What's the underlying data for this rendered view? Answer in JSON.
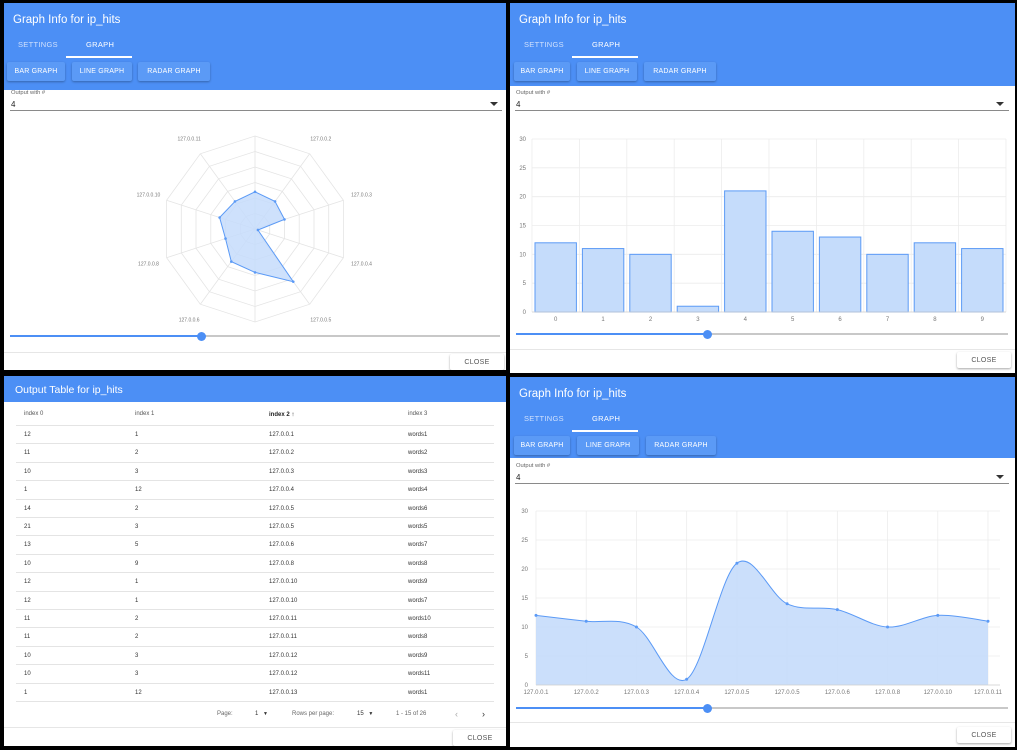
{
  "radar_panel": {
    "title": "Graph Info for ip_hits",
    "tabs": [
      "SETTINGS",
      "GRAPH"
    ],
    "buttons": [
      "BAR GRAPH",
      "LINE GRAPH",
      "RADAR GRAPH"
    ],
    "output_label": "Output with #",
    "output_value": "4",
    "slider_value": 0.39,
    "close_label": "CLOSE"
  },
  "bar_panel": {
    "title": "Graph Info for ip_hits",
    "tabs": [
      "SETTINGS",
      "GRAPH"
    ],
    "buttons": [
      "BAR GRAPH",
      "LINE GRAPH",
      "RADAR GRAPH"
    ],
    "output_label": "Output with #",
    "output_value": "4",
    "slider_value": 0.39,
    "close_label": "CLOSE"
  },
  "line_panel": {
    "title": "Graph Info for ip_hits",
    "tabs": [
      "SETTINGS",
      "GRAPH"
    ],
    "buttons": [
      "BAR GRAPH",
      "LINE GRAPH",
      "RADAR GRAPH"
    ],
    "output_label": "Output with #",
    "output_value": "4",
    "slider_value": 0.39,
    "close_label": "CLOSE"
  },
  "table_panel": {
    "title": "Output Table for ip_hits",
    "columns": [
      "index 0",
      "index 1",
      "index 2",
      "index 3"
    ],
    "sort_icon": "arrow-up-icon",
    "rows": [
      [
        "12",
        "1",
        "127.0.0.1",
        "words1"
      ],
      [
        "11",
        "2",
        "127.0.0.2",
        "words2"
      ],
      [
        "10",
        "3",
        "127.0.0.3",
        "words3"
      ],
      [
        "1",
        "12",
        "127.0.0.4",
        "words4"
      ],
      [
        "14",
        "2",
        "127.0.0.5",
        "words6"
      ],
      [
        "21",
        "3",
        "127.0.0.5",
        "words5"
      ],
      [
        "13",
        "5",
        "127.0.0.6",
        "words7"
      ],
      [
        "10",
        "9",
        "127.0.0.8",
        "words8"
      ],
      [
        "12",
        "1",
        "127.0.0.10",
        "words9"
      ],
      [
        "12",
        "1",
        "127.0.0.10",
        "words7"
      ],
      [
        "11",
        "2",
        "127.0.0.11",
        "words10"
      ],
      [
        "11",
        "2",
        "127.0.0.11",
        "words8"
      ],
      [
        "10",
        "3",
        "127.0.0.12",
        "words9"
      ],
      [
        "10",
        "3",
        "127.0.0.12",
        "words11"
      ],
      [
        "1",
        "12",
        "127.0.0.13",
        "words1"
      ]
    ],
    "pagination": {
      "page_label": "Page:",
      "page_value": "1",
      "rows_label": "Rows per page:",
      "rows_value": "15",
      "range": "1 - 15 of 26"
    },
    "close_label": "CLOSE"
  },
  "colors": {
    "header": "#4c8ff5",
    "fill": "#c5dcfb",
    "stroke": "#5b9af6"
  },
  "chart_data": [
    {
      "type": "radar",
      "categories": [
        "127.0.0.1",
        "127.0.0.2",
        "127.0.0.3",
        "127.0.0.4",
        "127.0.0.5",
        "127.0.0.5",
        "127.0.0.6",
        "127.0.0.8",
        "127.0.0.10",
        "127.0.0.11"
      ],
      "values": [
        12,
        11,
        10,
        1,
        21,
        14,
        13,
        10,
        12,
        11
      ],
      "rmax": 30
    },
    {
      "type": "bar",
      "categories": [
        "0",
        "1",
        "2",
        "3",
        "4",
        "5",
        "6",
        "7",
        "8",
        "9"
      ],
      "values": [
        12,
        11,
        10,
        1,
        21,
        14,
        13,
        10,
        12,
        11
      ],
      "ylim": [
        0,
        30
      ],
      "yticks": [
        "0",
        "5",
        "10",
        "15",
        "20",
        "25",
        "30"
      ]
    },
    {
      "type": "area",
      "categories": [
        "127.0.0.1",
        "127.0.0.2",
        "127.0.0.3",
        "127.0.0.4",
        "127.0.0.5",
        "127.0.0.5",
        "127.0.0.6",
        "127.0.0.8",
        "127.0.0.10",
        "127.0.0.11"
      ],
      "values": [
        12,
        11,
        10,
        1,
        21,
        14,
        13,
        10,
        12,
        11
      ],
      "ylim": [
        0,
        30
      ],
      "yticks": [
        "0",
        "5",
        "10",
        "15",
        "20",
        "25",
        "30"
      ]
    }
  ]
}
